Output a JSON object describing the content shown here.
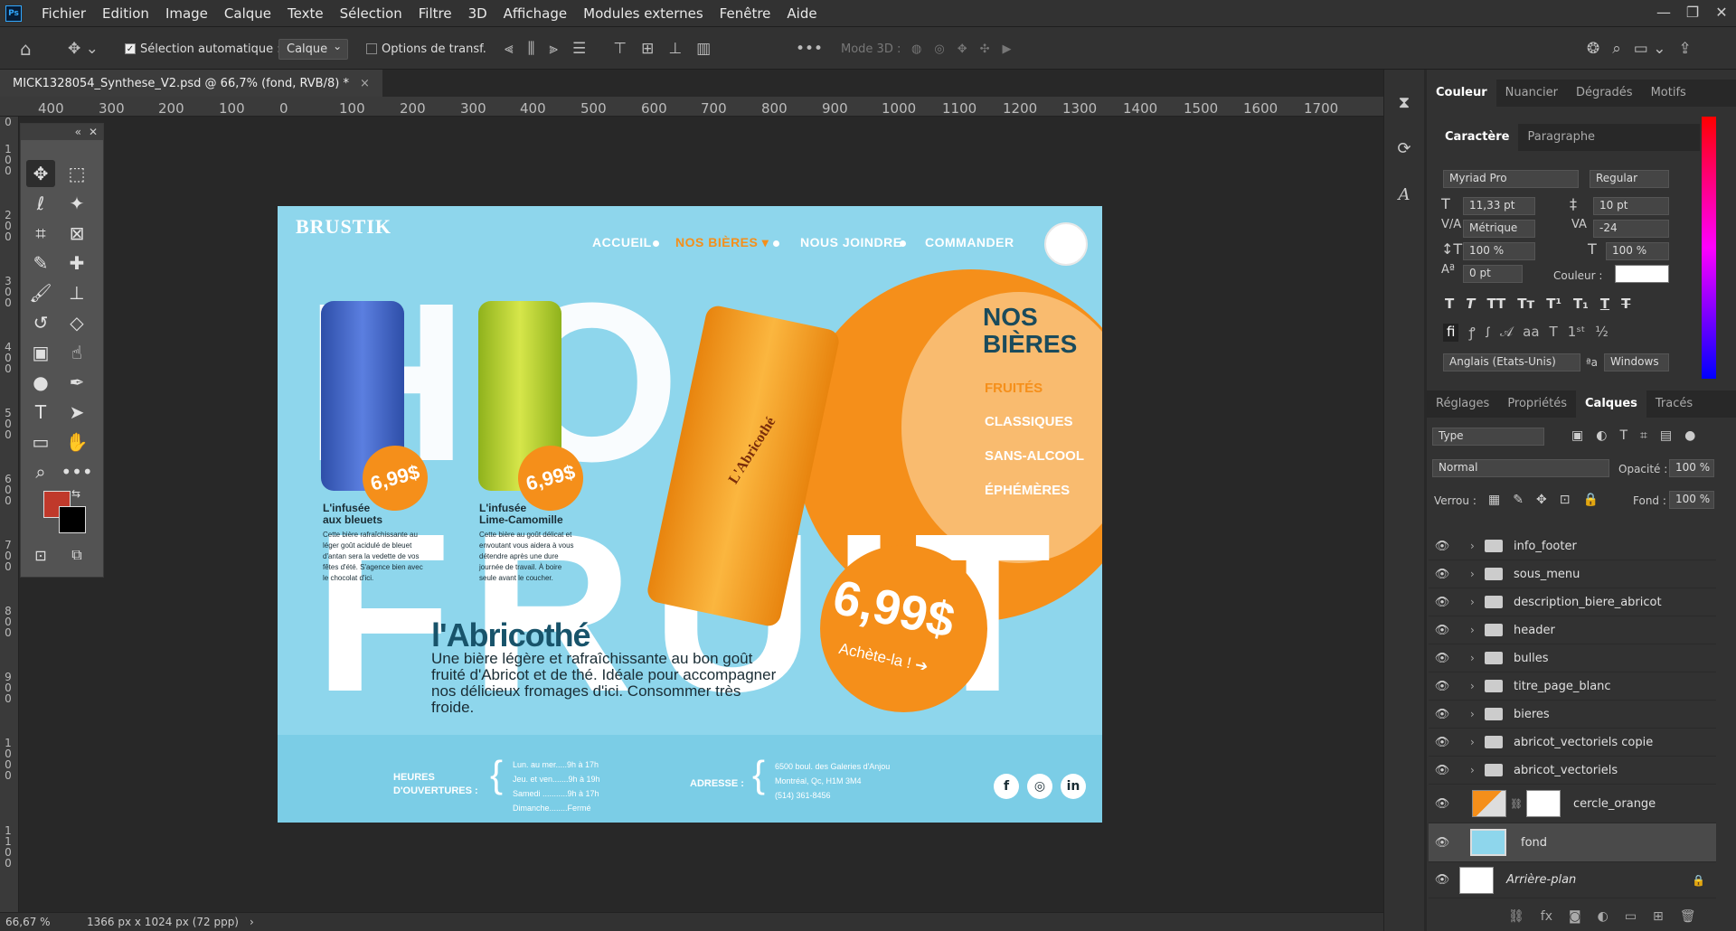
{
  "app": {
    "logo": "Ps"
  },
  "menu": [
    "Fichier",
    "Edition",
    "Image",
    "Calque",
    "Texte",
    "Sélection",
    "Filtre",
    "3D",
    "Affichage",
    "Modules externes",
    "Fenêtre",
    "Aide"
  ],
  "window_controls": [
    "—",
    "❐",
    "✕"
  ],
  "options": {
    "auto_select_label": "Sélection automatique :",
    "auto_select_value": "Calque",
    "transform_label": "Options de transf.",
    "mode3d": "Mode 3D :"
  },
  "document_tab": {
    "title": "MICK1328054_Synthese_V2.psd @ 66,7% (fond, RVB/8) *",
    "close": "×"
  },
  "ruler_top": [
    "400",
    "300",
    "200",
    "100",
    "0",
    "100",
    "200",
    "300",
    "400",
    "500",
    "600",
    "700",
    "800",
    "900",
    "1000",
    "1100",
    "1200",
    "1300",
    "1400",
    "1500",
    "1600",
    "1700"
  ],
  "ruler_left": [
    "0",
    "1 0 0",
    "2 0 0",
    "3 0 0",
    "4 0 0",
    "5 0 0",
    "6 0 0",
    "7 0 0",
    "8 0 0",
    "9 0 0",
    "1 0 0 0",
    "1 1 0 0"
  ],
  "status": {
    "zoom": "66,67 %",
    "info": "1366 px x 1024 px (72 ppp)",
    "arrow": "›"
  },
  "artwork": {
    "logo": "BRUSTIK",
    "nav": [
      "ACCUEIL",
      "NOS BIÈRES ▾",
      "NOUS JOINDRE",
      "COMMANDER"
    ],
    "bg_words": {
      "hop": "HO",
      "fruit": "FRUIT"
    },
    "section_title_1": "NOS",
    "section_title_2": "BIÈRES",
    "categories": [
      "FRUITÉS",
      "CLASSIQUES",
      "SANS-ALCOOL",
      "ÉPHÉMÈRES"
    ],
    "products": [
      {
        "name_1": "L'infusée",
        "name_2": "aux bleuets",
        "price": "6,99$",
        "desc": "Cette bière rafraîchissante au léger goût acidulé de bleuet d'antan sera la vedette de vos fêtes d'été. S'agence bien avec le chocolat d'ici."
      },
      {
        "name_1": "L'infusée",
        "name_2": "Lime-Camomille",
        "price": "6,99$",
        "desc": "Cette bière au goût délicat et envoutant vous aidera à vous détendre après une dure journée de travail. À boire seule avant le coucher."
      }
    ],
    "featured": {
      "title": "l'Abricothé",
      "desc": "Une bière légère et rafraîchissante au bon goût fruité d'Abricot et de thé. Idéale pour accompagner nos délicieux fromages d'ici. Consommer très froide.",
      "price": "6,99$",
      "cta": "Achète-la ! ➔",
      "can_label": "L'Abricothé"
    },
    "footer": {
      "hours_label_1": "HEURES",
      "hours_label_2": "D'OUVERTURES :",
      "hours": [
        "Lun. au mer.....9h à 17h",
        "Jeu. et ven.......9h à 19h",
        "Samedi ...........9h à 17h",
        "Dimanche........Fermé"
      ],
      "address_label": "ADRESSE :",
      "address": [
        "6500 boul. des Galeries d'Anjou",
        "Montréal, Qc, H1M 3M4",
        "(514) 361-8456"
      ],
      "social": [
        "f",
        "◎",
        "in"
      ]
    }
  },
  "panels": {
    "color_tabs": [
      "Couleur",
      "Nuancier",
      "Dégradés",
      "Motifs"
    ],
    "char_tabs": [
      "Caractère",
      "Paragraphe"
    ],
    "font": "Myriad Pro",
    "style": "Regular",
    "size": "11,33 pt",
    "leading": "10 pt",
    "kerning": "Métrique",
    "tracking": "-24",
    "vscale": "100 %",
    "hscale": "100 %",
    "baseline": "0 pt",
    "color_label": "Couleur :",
    "language": "Anglais (Etats-Unis)",
    "aa_label": "ªa",
    "aa": "Windows",
    "layer_tabs": [
      "Réglages",
      "Propriétés",
      "Calques",
      "Tracés"
    ],
    "filter": "Type",
    "blend": "Normal",
    "opacity_label": "Opacité :",
    "opacity": "100 %",
    "lock_label": "Verrou :",
    "fill_label": "Fond :",
    "fill": "100 %",
    "layers": [
      "info_footer",
      "sous_menu",
      "description_biere_abricot",
      "header",
      "bulles",
      "titre_page_blanc",
      "bieres",
      "abricot_vectoriels copie",
      "abricot_vectoriels"
    ],
    "layer_orange": "cercle_orange",
    "layer_fond": "fond",
    "layer_bg": "Arrière-plan"
  }
}
